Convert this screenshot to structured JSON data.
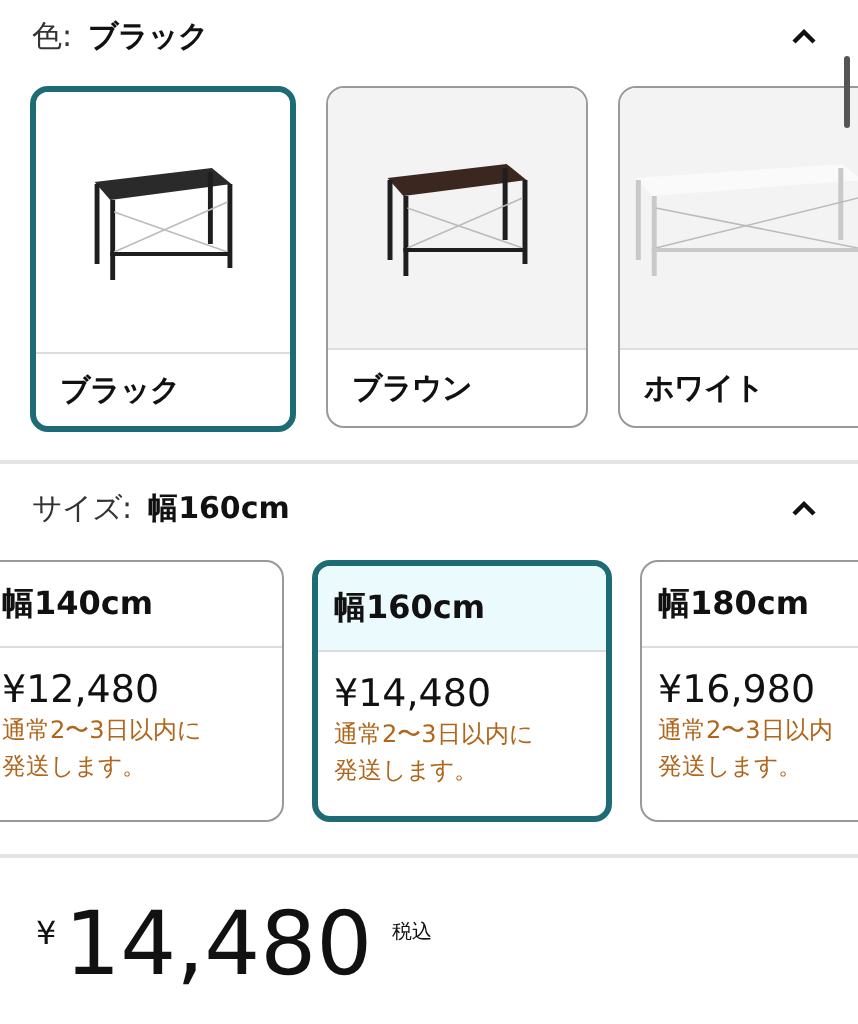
{
  "color_section": {
    "label": "色:",
    "value": "ブラック",
    "expanded": true,
    "options": [
      {
        "label": "ブラック",
        "selected": true
      },
      {
        "label": "ブラウン",
        "selected": false
      },
      {
        "label": "ホワイト",
        "selected": false
      }
    ]
  },
  "size_section": {
    "label": "サイズ:",
    "value": "幅160cm",
    "expanded": true,
    "options": [
      {
        "label": "幅140cm",
        "price": "¥12,480",
        "shipping": [
          "通常2〜3日以内に",
          "発送します。"
        ],
        "selected": false
      },
      {
        "label": "幅160cm",
        "price": "¥14,480",
        "shipping": [
          "通常2〜3日以内に",
          "発送します。"
        ],
        "selected": true
      },
      {
        "label": "幅180cm",
        "price": "¥16,980",
        "shipping": [
          "通常2〜3日以内",
          "発送します。"
        ],
        "selected": false
      }
    ]
  },
  "price": {
    "currency": "¥",
    "amount": "14,480",
    "tax_note": "税込"
  }
}
